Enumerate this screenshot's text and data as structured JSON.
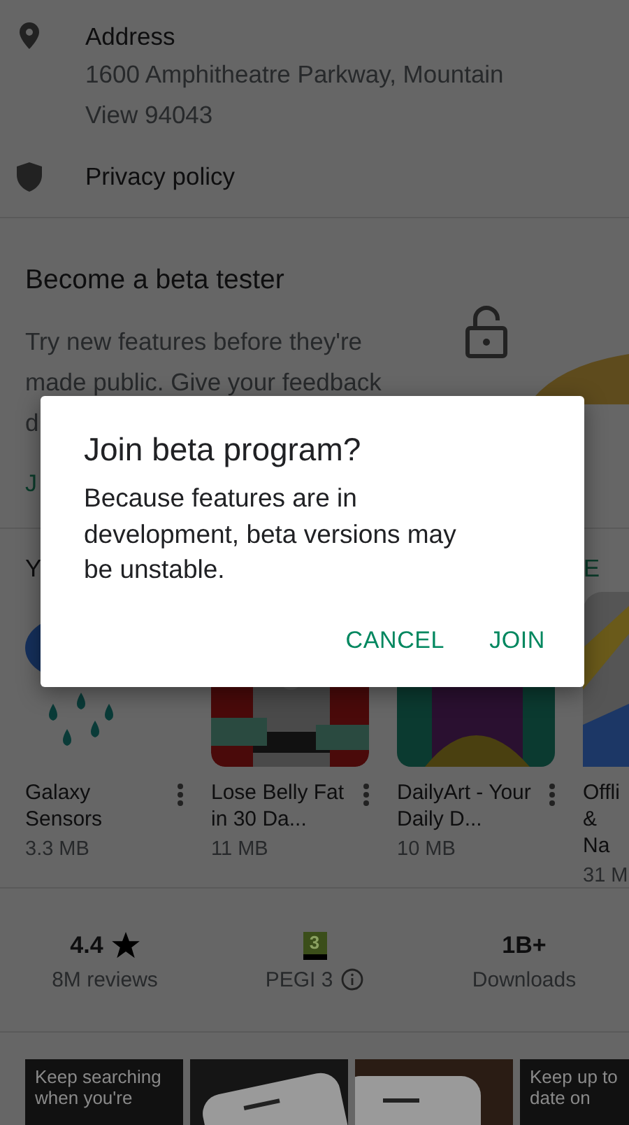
{
  "details": [
    {
      "kind": "address",
      "label": "Address",
      "value": "1600 Amphitheatre Parkway, Mountain View 94043"
    },
    {
      "kind": "privacy",
      "label": "Privacy policy"
    }
  ],
  "beta": {
    "title": "Become a beta tester",
    "text": "Try new features before they're\nmade public. Give your feedback\nd",
    "join_label": "J"
  },
  "apps": {
    "header": "Y",
    "more": "E",
    "items": [
      {
        "kind": "weather",
        "name": "Galaxy Sensors",
        "size": "3.3 MB"
      },
      {
        "kind": "picture",
        "name": "Lose Belly Fat in 30 Da...",
        "size": "11 MB"
      },
      {
        "kind": "picture",
        "name": "DailyArt - Your Daily D...",
        "size": "10 MB"
      },
      {
        "kind": "map",
        "name": "Offli & Na",
        "size": "31 M"
      }
    ]
  },
  "stats": [
    {
      "kind": "rating",
      "value": "4.4",
      "caption": "8M reviews"
    },
    {
      "kind": "content_rating",
      "badge": "3",
      "caption": "PEGI 3"
    },
    {
      "kind": "downloads",
      "value": "1B+",
      "caption": "Downloads"
    }
  ],
  "screenshots": [
    {
      "caption": "Keep searching when you're"
    },
    {
      "kind": "picture"
    },
    {
      "kind": "picture"
    },
    {
      "caption": "Keep up to date on"
    }
  ],
  "dialog": {
    "title": "Join beta program?",
    "message": "Because features are in development, beta versions may be unstable.",
    "buttons": [
      "CANCEL",
      "JOIN"
    ]
  }
}
